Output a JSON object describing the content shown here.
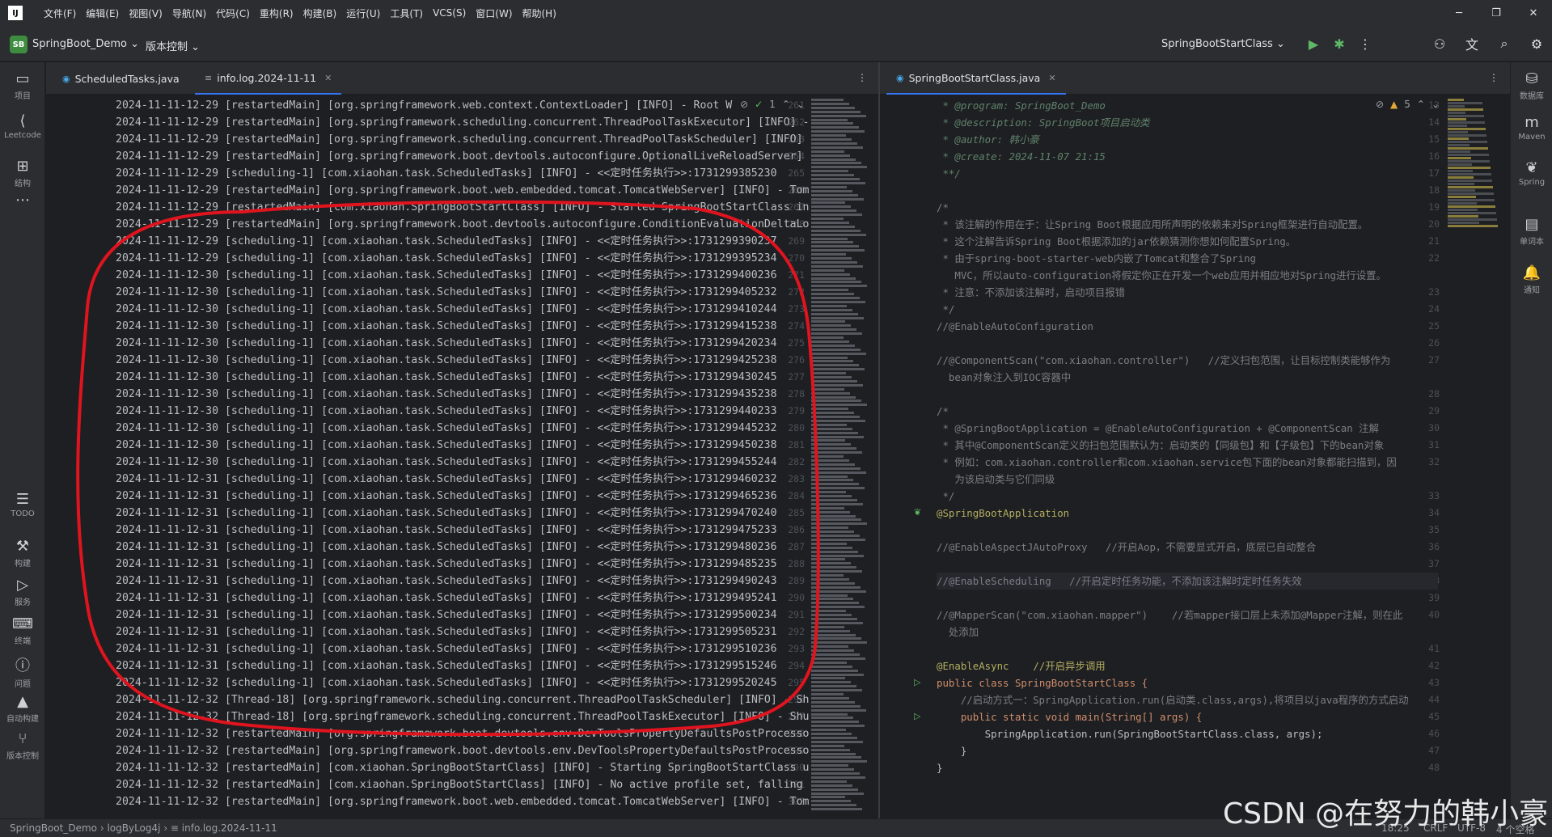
{
  "menu": {
    "items": [
      "文件(F)",
      "编辑(E)",
      "视图(V)",
      "导航(N)",
      "代码(C)",
      "重构(R)",
      "构建(B)",
      "运行(U)",
      "工具(T)",
      "VCS(S)",
      "窗口(W)",
      "帮助(H)"
    ]
  },
  "toolbar": {
    "project_badge": "SB",
    "project_name": "SpringBoot_Demo",
    "vcs_label": "版本控制",
    "run_config": "SpringBootStartClass"
  },
  "left_strip": {
    "items": [
      {
        "icon": "folder-icon",
        "label": "项目"
      },
      {
        "icon": "leetcode-icon",
        "label": "Leetcode"
      },
      {
        "icon": "structure-icon",
        "label": "结构"
      },
      {
        "icon": "more-icon",
        "label": ""
      },
      {
        "icon": "todo-icon",
        "label": "TODO"
      },
      {
        "icon": "build-icon",
        "label": "构建"
      },
      {
        "icon": "services-icon",
        "label": "服务"
      },
      {
        "icon": "terminal-icon",
        "label": "终端"
      },
      {
        "icon": "problems-icon",
        "label": "问题"
      },
      {
        "icon": "autobuild-icon",
        "label": "自动构建"
      },
      {
        "icon": "vcs-icon",
        "label": "版本控制"
      }
    ]
  },
  "right_strip": {
    "items": [
      {
        "icon": "database-icon",
        "label": "数据库"
      },
      {
        "icon": "maven-icon",
        "label": "Maven"
      },
      {
        "icon": "spring-icon",
        "label": "Spring"
      },
      {
        "icon": "wordbook-icon",
        "label": "单词本"
      },
      {
        "icon": "notification-icon",
        "label": "通知"
      }
    ]
  },
  "left_editor": {
    "tabs": [
      {
        "label": "ScheduledTasks.java",
        "active": false
      },
      {
        "label": "info.log.2024-11-11",
        "active": true
      }
    ],
    "inspection": "1",
    "lines": [
      {
        "n": "261",
        "t": "2024-11-11-12-29 [restartedMain] [org.springframework.web.context.ContextLoader] [INFO] - Root W"
      },
      {
        "n": "262",
        "t": "2024-11-11-12-29 [restartedMain] [org.springframework.scheduling.concurrent.ThreadPoolTaskExecutor] [INFO] -"
      },
      {
        "n": "263",
        "t": "2024-11-11-12-29 [restartedMain] [org.springframework.scheduling.concurrent.ThreadPoolTaskScheduler] [INFO]"
      },
      {
        "n": "264",
        "t": "2024-11-11-12-29 [restartedMain] [org.springframework.boot.devtools.autoconfigure.OptionalLiveReloadServer]"
      },
      {
        "n": "265",
        "t": "2024-11-11-12-29 [scheduling-1] [com.xiaohan.task.ScheduledTasks] [INFO] - <<定时任务执行>>:1731299385230"
      },
      {
        "n": "266",
        "t": "2024-11-11-12-29 [restartedMain] [org.springframework.boot.web.embedded.tomcat.TomcatWebServer] [INFO] - Tom"
      },
      {
        "n": "267",
        "t": "2024-11-11-12-29 [restartedMain] [com.xiaohan.SpringBootStartClass] [INFO] - Started SpringBootStartClass in"
      },
      {
        "n": "268",
        "t": "2024-11-11-12-29 [restartedMain] [org.springframework.boot.devtools.autoconfigure.ConditionEvaluationDeltaLo"
      },
      {
        "n": "269",
        "t": "2024-11-11-12-29 [scheduling-1] [com.xiaohan.task.ScheduledTasks] [INFO] - <<定时任务执行>>:1731299390237"
      },
      {
        "n": "270",
        "t": "2024-11-11-12-29 [scheduling-1] [com.xiaohan.task.ScheduledTasks] [INFO] - <<定时任务执行>>:1731299395234"
      },
      {
        "n": "271",
        "t": "2024-11-11-12-30 [scheduling-1] [com.xiaohan.task.ScheduledTasks] [INFO] - <<定时任务执行>>:1731299400236"
      },
      {
        "n": "272",
        "t": "2024-11-11-12-30 [scheduling-1] [com.xiaohan.task.ScheduledTasks] [INFO] - <<定时任务执行>>:1731299405232"
      },
      {
        "n": "273",
        "t": "2024-11-11-12-30 [scheduling-1] [com.xiaohan.task.ScheduledTasks] [INFO] - <<定时任务执行>>:1731299410244"
      },
      {
        "n": "274",
        "t": "2024-11-11-12-30 [scheduling-1] [com.xiaohan.task.ScheduledTasks] [INFO] - <<定时任务执行>>:1731299415238"
      },
      {
        "n": "275",
        "t": "2024-11-11-12-30 [scheduling-1] [com.xiaohan.task.ScheduledTasks] [INFO] - <<定时任务执行>>:1731299420234"
      },
      {
        "n": "276",
        "t": "2024-11-11-12-30 [scheduling-1] [com.xiaohan.task.ScheduledTasks] [INFO] - <<定时任务执行>>:1731299425238"
      },
      {
        "n": "277",
        "t": "2024-11-11-12-30 [scheduling-1] [com.xiaohan.task.ScheduledTasks] [INFO] - <<定时任务执行>>:1731299430245"
      },
      {
        "n": "278",
        "t": "2024-11-11-12-30 [scheduling-1] [com.xiaohan.task.ScheduledTasks] [INFO] - <<定时任务执行>>:1731299435238"
      },
      {
        "n": "279",
        "t": "2024-11-11-12-30 [scheduling-1] [com.xiaohan.task.ScheduledTasks] [INFO] - <<定时任务执行>>:1731299440233"
      },
      {
        "n": "280",
        "t": "2024-11-11-12-30 [scheduling-1] [com.xiaohan.task.ScheduledTasks] [INFO] - <<定时任务执行>>:1731299445232"
      },
      {
        "n": "281",
        "t": "2024-11-11-12-30 [scheduling-1] [com.xiaohan.task.ScheduledTasks] [INFO] - <<定时任务执行>>:1731299450238"
      },
      {
        "n": "282",
        "t": "2024-11-11-12-30 [scheduling-1] [com.xiaohan.task.ScheduledTasks] [INFO] - <<定时任务执行>>:1731299455244"
      },
      {
        "n": "283",
        "t": "2024-11-11-12-31 [scheduling-1] [com.xiaohan.task.ScheduledTasks] [INFO] - <<定时任务执行>>:1731299460232"
      },
      {
        "n": "284",
        "t": "2024-11-11-12-31 [scheduling-1] [com.xiaohan.task.ScheduledTasks] [INFO] - <<定时任务执行>>:1731299465236"
      },
      {
        "n": "285",
        "t": "2024-11-11-12-31 [scheduling-1] [com.xiaohan.task.ScheduledTasks] [INFO] - <<定时任务执行>>:1731299470240"
      },
      {
        "n": "286",
        "t": "2024-11-11-12-31 [scheduling-1] [com.xiaohan.task.ScheduledTasks] [INFO] - <<定时任务执行>>:1731299475233"
      },
      {
        "n": "287",
        "t": "2024-11-11-12-31 [scheduling-1] [com.xiaohan.task.ScheduledTasks] [INFO] - <<定时任务执行>>:1731299480236"
      },
      {
        "n": "288",
        "t": "2024-11-11-12-31 [scheduling-1] [com.xiaohan.task.ScheduledTasks] [INFO] - <<定时任务执行>>:1731299485235"
      },
      {
        "n": "289",
        "t": "2024-11-11-12-31 [scheduling-1] [com.xiaohan.task.ScheduledTasks] [INFO] - <<定时任务执行>>:1731299490243"
      },
      {
        "n": "290",
        "t": "2024-11-11-12-31 [scheduling-1] [com.xiaohan.task.ScheduledTasks] [INFO] - <<定时任务执行>>:1731299495241"
      },
      {
        "n": "291",
        "t": "2024-11-11-12-31 [scheduling-1] [com.xiaohan.task.ScheduledTasks] [INFO] - <<定时任务执行>>:1731299500234"
      },
      {
        "n": "292",
        "t": "2024-11-11-12-31 [scheduling-1] [com.xiaohan.task.ScheduledTasks] [INFO] - <<定时任务执行>>:1731299505231"
      },
      {
        "n": "293",
        "t": "2024-11-11-12-31 [scheduling-1] [com.xiaohan.task.ScheduledTasks] [INFO] - <<定时任务执行>>:1731299510236"
      },
      {
        "n": "294",
        "t": "2024-11-11-12-31 [scheduling-1] [com.xiaohan.task.ScheduledTasks] [INFO] - <<定时任务执行>>:1731299515246"
      },
      {
        "n": "295",
        "t": "2024-11-11-12-32 [scheduling-1] [com.xiaohan.task.ScheduledTasks] [INFO] - <<定时任务执行>>:1731299520245"
      },
      {
        "n": "296",
        "t": "2024-11-11-12-32 [Thread-18] [org.springframework.scheduling.concurrent.ThreadPoolTaskScheduler] [INFO] - Sh"
      },
      {
        "n": "297",
        "t": "2024-11-11-12-32 [Thread-18] [org.springframework.scheduling.concurrent.ThreadPoolTaskExecutor] [INFO] - Shu"
      },
      {
        "n": "298",
        "t": "2024-11-11-12-32 [restartedMain] [org.springframework.boot.devtools.env.DevToolsPropertyDefaultsPostProcesso"
      },
      {
        "n": "299",
        "t": "2024-11-11-12-32 [restartedMain] [org.springframework.boot.devtools.env.DevToolsPropertyDefaultsPostProcesso"
      },
      {
        "n": "300",
        "t": "2024-11-11-12-32 [restartedMain] [com.xiaohan.SpringBootStartClass] [INFO] - Starting SpringBootStartClass u"
      },
      {
        "n": "301",
        "t": "2024-11-11-12-32 [restartedMain] [com.xiaohan.SpringBootStartClass] [INFO] - No active profile set, falling"
      },
      {
        "n": "302",
        "t": "2024-11-11-12-32 [restartedMain] [org.springframework.boot.web.embedded.tomcat.TomcatWebServer] [INFO] - Tom"
      }
    ]
  },
  "right_editor": {
    "tabs": [
      {
        "label": "SpringBootStartClass.java",
        "active": true
      }
    ],
    "warnings": "5",
    "lines": [
      {
        "n": "13",
        "t": " * @program: SpringBoot_Demo",
        "k": "doc"
      },
      {
        "n": "14",
        "t": " * @description: SpringBoot项目启动类",
        "k": "doc"
      },
      {
        "n": "15",
        "t": " * @author: 韩小豪",
        "k": "doc"
      },
      {
        "n": "16",
        "t": " * @create: 2024-11-07 21:15",
        "k": "doc"
      },
      {
        "n": "17",
        "t": " **/",
        "k": "doc"
      },
      {
        "n": "18",
        "t": "",
        "k": "plain"
      },
      {
        "n": "19",
        "t": "/*",
        "k": "cmt"
      },
      {
        "n": "20",
        "t": " * 该注解的作用在于：让Spring Boot根据应用所声明的依赖来对Spring框架进行自动配置。",
        "k": "cmt"
      },
      {
        "n": "21",
        "t": " * 这个注解告诉Spring Boot根据添加的jar依赖猜测你想如何配置Spring。",
        "k": "cmt"
      },
      {
        "n": "22",
        "t": " * 由于spring-boot-starter-web内嵌了Tomcat和整合了Spring",
        "k": "cmt"
      },
      {
        "n": "",
        "t": "   MVC，所以auto-configuration将假定你正在开发一个web应用并相应地对Spring进行设置。",
        "k": "cmt"
      },
      {
        "n": "23",
        "t": " * 注意：不添加该注解时，启动项目报错",
        "k": "cmt"
      },
      {
        "n": "24",
        "t": " */",
        "k": "cmt"
      },
      {
        "n": "25",
        "t": "//@EnableAutoConfiguration",
        "k": "cmt"
      },
      {
        "n": "26",
        "t": "",
        "k": "plain"
      },
      {
        "n": "27",
        "t": "//@ComponentScan(\"com.xiaohan.controller\")   //定义扫包范围，让目标控制类能够作为",
        "k": "cmt"
      },
      {
        "n": "",
        "t": "  bean对象注入到IOC容器中",
        "k": "cmt"
      },
      {
        "n": "28",
        "t": "",
        "k": "plain"
      },
      {
        "n": "29",
        "t": "/*",
        "k": "cmt"
      },
      {
        "n": "30",
        "t": " * @SpringBootApplication = @EnableAutoConfiguration + @ComponentScan 注解",
        "k": "cmt"
      },
      {
        "n": "31",
        "t": " * 其中@ComponentScan定义的扫包范围默认为：启动类的【同级包】和【子级包】下的bean对象",
        "k": "cmt"
      },
      {
        "n": "32",
        "t": " * 例如：com.xiaohan.controller和com.xiaohan.service包下面的bean对象都能扫描到，因",
        "k": "cmt"
      },
      {
        "n": "",
        "t": "   为该启动类与它们同级",
        "k": "cmt"
      },
      {
        "n": "33",
        "t": " */",
        "k": "cmt"
      },
      {
        "n": "34",
        "t": "@SpringBootApplication",
        "k": "ann"
      },
      {
        "n": "35",
        "t": "",
        "k": "plain"
      },
      {
        "n": "36",
        "t": "//@EnableAspectJAutoProxy   //开启Aop，不需要显式开启，底层已自动整合",
        "k": "cmt"
      },
      {
        "n": "37",
        "t": "",
        "k": "plain"
      },
      {
        "n": "38",
        "t": "//@EnableScheduling   //开启定时任务功能，不添加该注解时定时任务失效",
        "k": "cmt"
      },
      {
        "n": "39",
        "t": "",
        "k": "plain"
      },
      {
        "n": "40",
        "t": "//@MapperScan(\"com.xiaohan.mapper\")    //若mapper接口层上未添加@Mapper注解，则在此",
        "k": "cmt"
      },
      {
        "n": "",
        "t": "  处添加",
        "k": "cmt"
      },
      {
        "n": "41",
        "t": "",
        "k": "plain"
      },
      {
        "n": "42",
        "t": "@EnableAsync    //开启异步调用",
        "k": "ann"
      },
      {
        "n": "43",
        "t": "public class SpringBootStartClass {",
        "k": "kw"
      },
      {
        "n": "44",
        "t": "    //启动方式一：SpringApplication.run(启动类.class,args),将项目以java程序的方式启动",
        "k": "cmt"
      },
      {
        "n": "45",
        "t": "    public static void main(String[] args) {",
        "k": "kw"
      },
      {
        "n": "46",
        "t": "        SpringApplication.run(SpringBootStartClass.class, args);",
        "k": "plain"
      },
      {
        "n": "47",
        "t": "    }",
        "k": "plain"
      },
      {
        "n": "48",
        "t": "}",
        "k": "plain"
      }
    ]
  },
  "status": {
    "crumbs": [
      "SpringBoot_Demo",
      "logByLog4j",
      "info.log.2024-11-11"
    ],
    "position": "18:25",
    "line_sep": "CRLF",
    "encoding": "UTF-8",
    "indent": "4 个空格"
  },
  "watermark": "CSDN @在努力的韩小豪",
  "colors": {
    "accent": "#3574f0",
    "annotation_circle": "#e0141e",
    "run": "#5fb865"
  }
}
